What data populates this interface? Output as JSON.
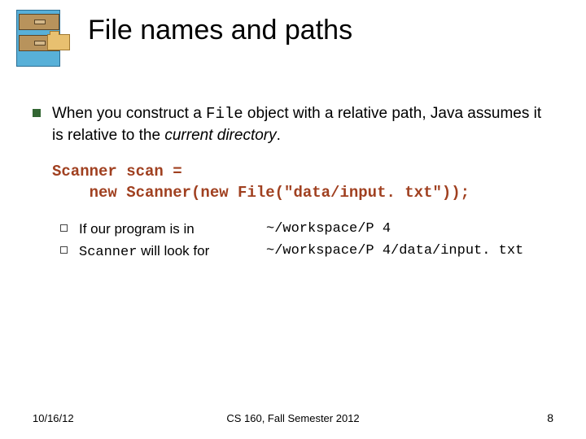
{
  "title": "File names and paths",
  "para_pre": "When you construct a ",
  "para_mono": "File",
  "para_mid": " object with a relative path, Java assumes it is relative to the ",
  "para_italic": "current directory",
  "para_post": ".",
  "code": "Scanner scan =\n    new Scanner(new File(\"data/input. txt\"));",
  "sub1_left_pre": "If our program is in",
  "sub1_right": "~/workspace/P 4",
  "sub2_left_mono": "Scanner",
  "sub2_left_rest": " will look for",
  "sub2_right": "~/workspace/P 4/data/input. txt",
  "footer_left": "10/16/12",
  "footer_center": "CS 160, Fall Semester 2012",
  "footer_right": "8"
}
